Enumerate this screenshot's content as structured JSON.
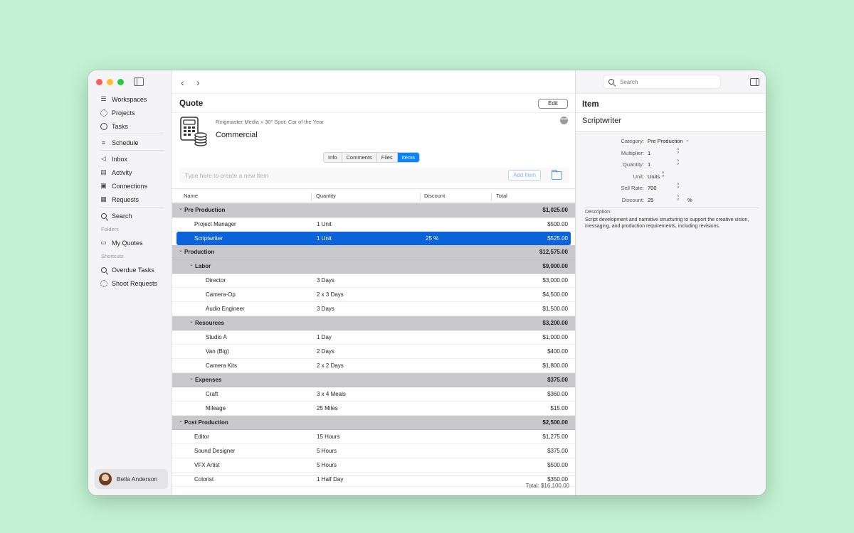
{
  "sidebar": {
    "items": [
      {
        "label": "Workspaces",
        "icon": "stack-icon"
      },
      {
        "label": "Projects",
        "icon": "dotted-circle-icon"
      },
      {
        "label": "Tasks",
        "icon": "circle-icon"
      },
      {
        "label": "Schedule",
        "icon": "schedule-icon"
      },
      {
        "label": "Inbox",
        "icon": "megaphone-icon"
      },
      {
        "label": "Activity",
        "icon": "activity-icon"
      },
      {
        "label": "Connections",
        "icon": "contact-icon"
      },
      {
        "label": "Requests",
        "icon": "requests-icon"
      },
      {
        "label": "Search",
        "icon": "search-icon"
      }
    ],
    "folders_heading": "Folders",
    "folder_item": "My Quotes",
    "shortcuts_heading": "Shortcuts",
    "shortcuts": [
      "Overdue Tasks",
      "Shoot Requests"
    ],
    "user_name": "Bella Anderson"
  },
  "main": {
    "title": "Quote",
    "edit_label": "Edit",
    "breadcrumb": "Ringmaster Media » 30\" Spot: Car of the Year",
    "project_name": "Commercial",
    "more_label": "•••",
    "tabs": [
      "Info",
      "Comments",
      "Files",
      "Items"
    ],
    "new_item_placeholder": "Type here to create a new Item",
    "add_item_label": "Add Item",
    "columns": [
      "Name",
      "Quantity",
      "Discount",
      "Total"
    ],
    "rows": [
      {
        "kind": "group",
        "level": 0,
        "name": "Pre Production",
        "total": "$1,025.00"
      },
      {
        "kind": "item",
        "level": 1,
        "name": "Project Manager",
        "qty": "1 Unit",
        "discount": "",
        "total": "$500.00"
      },
      {
        "kind": "item",
        "level": 1,
        "name": "Scriptwriter",
        "qty": "1 Unit",
        "discount": "25 %",
        "total": "$525.00",
        "selected": true
      },
      {
        "kind": "group",
        "level": 0,
        "name": "Production",
        "total": "$12,575.00"
      },
      {
        "kind": "group",
        "level": 1,
        "name": "Labor",
        "total": "$9,000.00"
      },
      {
        "kind": "item",
        "level": 2,
        "name": "Director",
        "qty": "3 Days",
        "discount": "",
        "total": "$3,000.00"
      },
      {
        "kind": "item",
        "level": 2,
        "name": "Camera-Op",
        "qty": "2 x 3 Days",
        "discount": "",
        "total": "$4,500.00"
      },
      {
        "kind": "item",
        "level": 2,
        "name": "Audio Engineer",
        "qty": "3 Days",
        "discount": "",
        "total": "$1,500.00"
      },
      {
        "kind": "group",
        "level": 1,
        "name": "Resources",
        "total": "$3,200.00"
      },
      {
        "kind": "item",
        "level": 2,
        "name": "Studio A",
        "qty": "1 Day",
        "discount": "",
        "total": "$1,000.00"
      },
      {
        "kind": "item",
        "level": 2,
        "name": "Van (Big)",
        "qty": "2 Days",
        "discount": "",
        "total": "$400.00"
      },
      {
        "kind": "item",
        "level": 2,
        "name": "Camera Kits",
        "qty": "2 x 2 Days",
        "discount": "",
        "total": "$1,800.00"
      },
      {
        "kind": "group",
        "level": 1,
        "name": "Expenses",
        "total": "$375.00"
      },
      {
        "kind": "item",
        "level": 2,
        "name": "Craft",
        "qty": "3 x 4 Meals",
        "discount": "",
        "total": "$360.00"
      },
      {
        "kind": "item",
        "level": 2,
        "name": "Mileage",
        "qty": "25 Miles",
        "discount": "",
        "total": "$15.00"
      },
      {
        "kind": "group",
        "level": 0,
        "name": "Post Production",
        "total": "$2,500.00"
      },
      {
        "kind": "item",
        "level": 1,
        "name": "Editor",
        "qty": "15 Hours",
        "discount": "",
        "total": "$1,275.00"
      },
      {
        "kind": "item",
        "level": 1,
        "name": "Sound Designer",
        "qty": "5 Hours",
        "discount": "",
        "total": "$375.00"
      },
      {
        "kind": "item",
        "level": 1,
        "name": "VFX Artist",
        "qty": "5 Hours",
        "discount": "",
        "total": "$500.00"
      },
      {
        "kind": "item",
        "level": 1,
        "name": "Colorist",
        "qty": "1 Half Day",
        "discount": "",
        "total": "$350.00"
      }
    ],
    "grand_total": "Total: $16,100.00"
  },
  "inspector": {
    "search_placeholder": "Search",
    "title": "Item",
    "item_name": "Scriptwriter",
    "fields": [
      {
        "label": "Category:",
        "value": "Pre Production",
        "control": "dropdown"
      },
      {
        "label": "Multiplier:",
        "value": "1",
        "control": "stepper"
      },
      {
        "label": "Quantity:",
        "value": "1",
        "control": "stepper"
      },
      {
        "label": "Unit:",
        "value": "Units",
        "control": "popup"
      },
      {
        "label": "Sell Rate:",
        "value": "700",
        "control": "stepper"
      },
      {
        "label": "Discount:",
        "value": "25",
        "control": "stepper",
        "suffix": "%"
      }
    ],
    "description_label": "Description:",
    "description": "Script development and narrative structuring to support the creative vision, messaging, and production requirements, including revisions."
  },
  "colors": {
    "accent": "#0a84ff",
    "selection": "#0a63d8",
    "group_row": "#c9c9cb",
    "background": "#c2f2d3"
  }
}
